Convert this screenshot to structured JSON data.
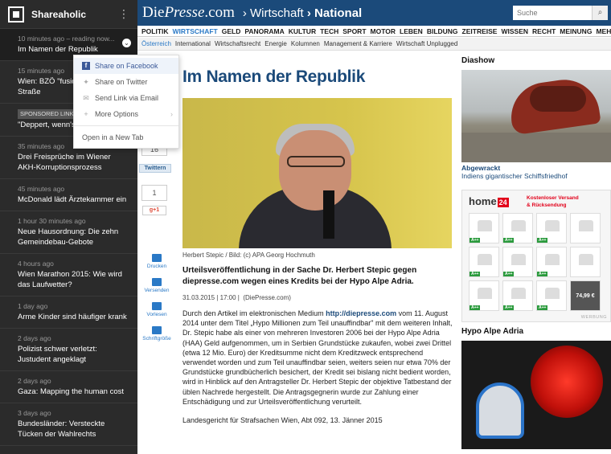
{
  "sidebar": {
    "title": "Shareaholic",
    "items": [
      {
        "time": "10 minutes ago – reading now...",
        "headline": "Im Namen der Republik"
      },
      {
        "time": "15 minutes ago",
        "headline": "Wien: BZÖ \"fusion... Mariahilfer-Straße"
      },
      {
        "sponsor": "SPONSORED LINK",
        "headline": "\"Deppert, wenn's s"
      },
      {
        "time": "35 minutes ago",
        "headline": "Drei Freisprüche im Wiener AKH-Korruptionsprozess"
      },
      {
        "time": "45 minutes ago",
        "headline": "McDonald lädt Ärztekammer ein"
      },
      {
        "time": "1 hour 30 minutes ago",
        "headline": "Neue Hausordnung: Die zehn Gemeindebau-Gebote"
      },
      {
        "time": "4 hours ago",
        "headline": "Wien Marathon 2015: Wie wird das Laufwetter?"
      },
      {
        "time": "1 day ago",
        "headline": "Arme Kinder sind häufiger krank"
      },
      {
        "time": "2 days ago",
        "headline": "Polizist schwer verletzt: Justudent angeklagt"
      },
      {
        "time": "2 days ago",
        "headline": "Gaza: Mapping the human cost"
      },
      {
        "time": "3 days ago",
        "headline": "Bundesländer: Versteckte Tücken der Wahlrechts"
      }
    ]
  },
  "share_menu": {
    "items": [
      "Share on Facebook",
      "Share on Twitter",
      "Send Link via Email",
      "More Options"
    ],
    "open_tab": "Open in a New Tab"
  },
  "header": {
    "brand_a": "Die",
    "brand_b": "Presse",
    "brand_c": ".com",
    "crumb1": "› Wirtschaft",
    "crumb2": "› National",
    "search_placeholder": "Suche"
  },
  "nav_main": [
    "POLITIK",
    "WIRTSCHAFT",
    "GELD",
    "PANORAMA",
    "KULTUR",
    "TECH",
    "SPORT",
    "MOTOR",
    "LEBEN",
    "BILDUNG",
    "ZEITREISE",
    "WISSEN",
    "RECHT",
    "MEINUNG",
    "MEHR »"
  ],
  "nav_sub": [
    "Österreich",
    "International",
    "Wirtschaftsrecht",
    "Energie",
    "Kolumnen",
    "Management & Karriere",
    "Wirtschaft Unplugged"
  ],
  "social": {
    "count_top": "16",
    "twitter": "Twittern",
    "count_g": "1",
    "gplus": "g+1",
    "tools": [
      "Drucken",
      "Versenden",
      "Vorlesen",
      "Schriftgröße"
    ]
  },
  "article": {
    "title": "Im Namen der Republik",
    "caption": "Herbert Stepic / Bild: (c) APA Georg Hochmuth",
    "lead": "Urteilsveröffentlichung in der Sache Dr. Herbert Stepic gegen diepresse.com wegen eines Kredits bei der Hypo Alpe Adria.",
    "date": "31.03.2015 | 17:00 |",
    "source": "(DiePresse.com)",
    "body_1": "Durch den Artikel im elektronischen Medium",
    "body_link": "http://diepresse.com",
    "body_2": "vom 11. August 2014 unter dem Titel „Hypo Millionen zum Teil unauffindbar\" mit dem weiteren Inhalt, Dr. Stepic habe als einer von mehreren Investoren 2006 bei der Hypo Alpe Adria (HAA) Geld aufgenommen, um in Serbien Grundstücke zukaufen, wobei zwei Drittel (etwa 12 Mio. Euro) der Kreditsumme nicht dem Kreditzweck entsprechend verwendet worden und zum Teil unauffindbar seien, weiters seien nur etwa 70% der Grundstücke grundbücherlich besichert, der Kredit sei bislang nicht bedient worden, wird in Hinblick auf den Antragsteller Dr. Herbert Stepic der objektive Tatbestand der üblen Nachrede hergestellt. Die Antragsgegnerin wurde zur Zahlung einer Entschädigung und zur Urteilsveröffentlichung verurteilt.",
    "footer": "Landesgericht für Strafsachen Wien, Abt 092, 13. Jänner 2015"
  },
  "right": {
    "diashow": "Diashow",
    "dia_title": "Abgewrackt",
    "dia_sub": "Indiens gigantischer Schiffsfriedhof",
    "ad_logo": "home",
    "ad_logo_num": "24",
    "ad_promo_1": "Kostenloser Versand",
    "ad_promo_2": "& Rücksendung",
    "ad_badge": "A++",
    "ad_price": "74,99 €",
    "ad_label": "WERBUNG",
    "hypo": "Hypo Alpe Adria"
  }
}
